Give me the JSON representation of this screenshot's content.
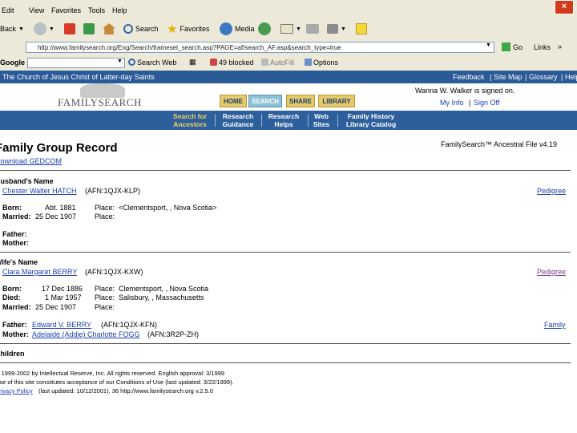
{
  "menu": [
    "Edit",
    "View",
    "Favorites",
    "Tools",
    "Help"
  ],
  "toolbar": {
    "back": "Back",
    "search": "Search",
    "favorites": "Favorites",
    "media": "Media",
    "go": "Go",
    "links": "Links"
  },
  "address": "http://www.familysearch.org/Eng/Search/frameset_search.asp?PAGE=af/search_AF.asp&search_type=true",
  "google": {
    "brand": "Google",
    "search_web": "Search Web",
    "blocked": "49 blocked",
    "autofill": "AutoFill",
    "options": "Options"
  },
  "site": {
    "church": "The Church of Jesus Christ of Latter-day Saints",
    "feedback": "Feedback",
    "sitemap": "Site Map",
    "glossary": "Glossary",
    "help": "Help",
    "logo": "FAMILYSEARCH",
    "signed_in": "Wanna W. Walker is signed on.",
    "myinfo": "My Info",
    "signoff": "Sign Off",
    "tabs": [
      "HOME",
      "SEARCH",
      "SHARE",
      "LIBRARY"
    ],
    "nav": [
      {
        "l1": "Search for",
        "l2": "Ancestors"
      },
      {
        "l1": "Research",
        "l2": "Guidance"
      },
      {
        "l1": "Research",
        "l2": "Helps"
      },
      {
        "l1": "Web",
        "l2": "Sites"
      },
      {
        "l1": "Family History",
        "l2": "Library Catalog"
      }
    ]
  },
  "record": {
    "title": "Family Group Record",
    "source": "FamilySearch™ Ancestral File v4.19",
    "download": "Download GEDCOM",
    "husband_heading": "Husband's Name",
    "husband_name": "Chester Walter HATCH",
    "husband_afn": "(AFN:1QJX-KLP)",
    "pedigree": "Pedigree",
    "h_born_label": "Born:",
    "h_born_date": "Abt. 1881",
    "h_born_place_label": "Place:",
    "h_born_place": "<Clementsport, , Nova Scotia>",
    "h_married_label": "Married:",
    "h_married_date": "25 Dec 1907",
    "h_married_place_label": "Place:",
    "h_father_label": "Father:",
    "h_mother_label": "Mother:",
    "wife_heading": "Wife's Name",
    "wife_name": "Clara Margaret BERRY",
    "wife_afn": "(AFN:1QJX-KXW)",
    "w_born_label": "Born:",
    "w_born_date": "17 Dec 1886",
    "w_born_place": "Clementsport, , Nova Scotia",
    "w_died_label": "Died:",
    "w_died_date": "1 Mar 1957",
    "w_died_place": "Salisbury, , Massachusetts",
    "w_married_label": "Married:",
    "w_married_date": "25 Dec 1907",
    "place_label": "Place:",
    "w_father_label": "Father:",
    "w_father": "Edward V. BERRY",
    "w_father_afn": "(AFN:1QJX-KFN)",
    "family": "Family",
    "w_mother_label": "Mother:",
    "w_mother": "Adelaide (Addie) Charlotte FOGG",
    "w_mother_afn": "(AFN:3R2P-ZH)",
    "children_heading": "Children"
  },
  "footer": {
    "line1": "© 1999-2002 by Intellectual Reserve, Inc. All rights reserved. English approval: 3/1999",
    "line2": "Use of this site constitutes acceptance of our Conditions of Use (last updated: 3/22/1999).",
    "privacy": "Privacy Policy",
    "line3": "(last updated: 10/12/2001). 36 http://www.familysearch.org v.2.5.0"
  }
}
